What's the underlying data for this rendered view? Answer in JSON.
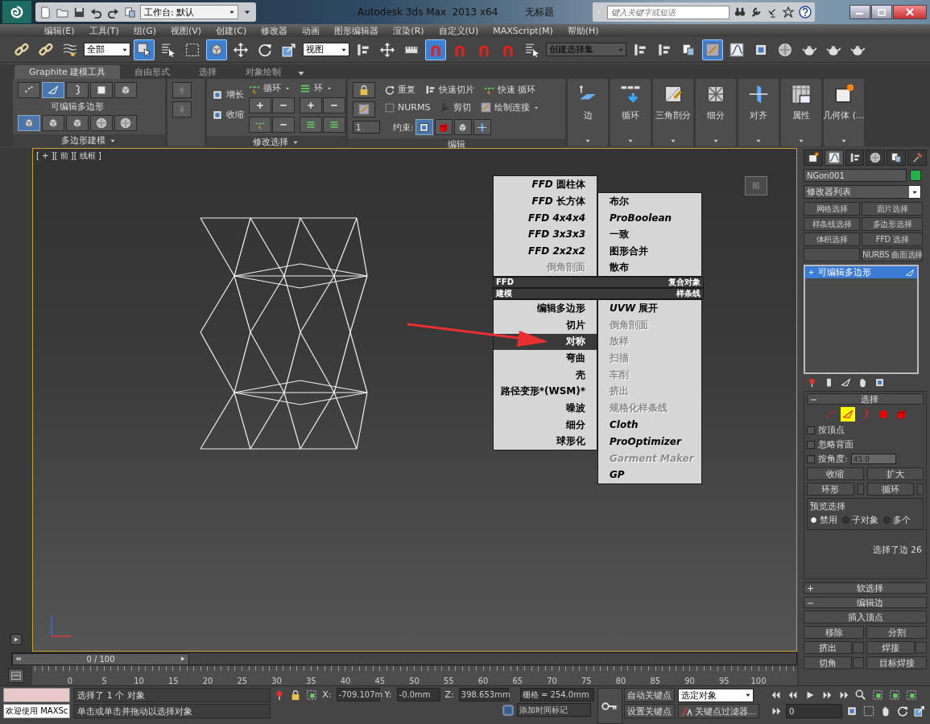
{
  "title_bar": {
    "workspace": "工作台: 默认",
    "app_title": "Autodesk 3ds Max  2013 x64",
    "document": "无标题",
    "search": {
      "placeholder": "键入关键字或短语"
    }
  },
  "menu_bar": [
    "编辑(E)",
    "工具(T)",
    "组(G)",
    "视图(V)",
    "创建(C)",
    "修改器",
    "动画",
    "图形编辑器",
    "渲染(R)",
    "自定义(U)",
    "MAXScript(M)",
    "帮助(H)"
  ],
  "main_toolbar": [
    {
      "kind": "tool",
      "selected": false
    },
    {
      "kind": "tool",
      "selected": false
    },
    {
      "kind": "tool",
      "selected": false
    },
    {
      "kind": "dropdown",
      "value": "全部"
    },
    {
      "kind": "tool",
      "selected": true
    },
    {
      "kind": "tool",
      "selected": false
    },
    {
      "kind": "tool",
      "selected": false
    },
    {
      "kind": "tool",
      "selected": true
    },
    {
      "kind": "tool",
      "selected": false
    },
    {
      "kind": "tool",
      "selected": false
    },
    {
      "kind": "tool",
      "selected": false
    },
    {
      "kind": "dropdown",
      "value": "视图"
    },
    {
      "kind": "tool",
      "selected": false
    },
    {
      "kind": "tool",
      "selected": false
    },
    {
      "kind": "tool",
      "selected": false
    },
    {
      "kind": "tool",
      "selected": true
    },
    {
      "kind": "tool",
      "selected": false
    },
    {
      "kind": "tool",
      "selected": false
    },
    {
      "kind": "tool",
      "selected": false
    },
    {
      "kind": "tool",
      "selected": false
    },
    {
      "kind": "dropdown",
      "value": "创建选择集"
    },
    {
      "kind": "tool",
      "selected": false
    },
    {
      "kind": "tool",
      "selected": false
    },
    {
      "kind": "tool",
      "selected": false
    },
    {
      "kind": "tool",
      "selected": true
    },
    {
      "kind": "tool",
      "selected": false
    },
    {
      "kind": "tool",
      "selected": false
    },
    {
      "kind": "tool",
      "selected": false
    },
    {
      "kind": "tool",
      "selected": false
    },
    {
      "kind": "tool",
      "selected": false
    },
    {
      "kind": "tool",
      "selected": false
    }
  ],
  "ribbon": {
    "tabs": [
      {
        "label": "Graphite 建模工具",
        "selected": true
      },
      {
        "label": "自由形式",
        "selected": false
      },
      {
        "label": "选择",
        "selected": false
      },
      {
        "label": "对象绘制",
        "selected": false
      }
    ],
    "poly_modeling": {
      "subobjects": [
        {
          "selected": false
        },
        {
          "selected": true
        },
        {
          "selected": false
        },
        {
          "selected": false
        },
        {
          "selected": false
        }
      ],
      "object_label": "可编辑多边形",
      "modes": [
        {
          "selected": true
        },
        {
          "selected": false
        },
        {
          "selected": false
        },
        {
          "selected": false
        },
        {
          "selected": false
        }
      ],
      "footer": "多边形建模"
    },
    "modify_selection": {
      "grow": "增长",
      "shrink": "收缩",
      "loop": "循环",
      "ring": "环",
      "footer": "修改选择"
    },
    "edit": {
      "repeat": "重复",
      "quick_slice": "快速切片",
      "quick_loop": "快速 循环",
      "nurms": "NURMS",
      "cut": "剪切",
      "paint_connect": "绘制连接",
      "constraints": "约束:",
      "spinner": "1",
      "footer": "编辑"
    },
    "large_buttons": [
      "边",
      "循环",
      "三角剖分",
      "细分",
      "对齐",
      "属性",
      "几何体 (..."
    ]
  },
  "viewport": {
    "label": "[ + ][ 前 ][ 线框 ]",
    "viewcube": "前",
    "quad_menu": {
      "left_top": [
        {
          "label": "*FFD* 圆柱体",
          "disabled": false,
          "selected": false
        },
        {
          "label": "*FFD* 长方体",
          "disabled": false,
          "selected": false
        },
        {
          "label": "FFD 4x4x4",
          "italic": true,
          "disabled": false,
          "selected": false
        },
        {
          "label": "FFD 3x3x3",
          "italic": true,
          "disabled": false,
          "selected": false
        },
        {
          "label": "FFD 2x2x2",
          "italic": true,
          "disabled": false,
          "selected": false
        },
        {
          "label": "倒角剖面",
          "disabled": true,
          "selected": false
        }
      ],
      "right_top": [
        {
          "label": "布尔",
          "disabled": false,
          "selected": false
        },
        {
          "label": "ProBoolean",
          "italic": true,
          "disabled": false,
          "selected": false
        },
        {
          "label": "一致",
          "disabled": false,
          "selected": false
        },
        {
          "label": "图形合并",
          "disabled": false,
          "selected": false
        },
        {
          "label": "散布",
          "disabled": false,
          "selected": false
        }
      ],
      "headers": [
        {
          "left": "FFD",
          "right": "复合对象"
        },
        {
          "left": "建模",
          "right": "样条线"
        }
      ],
      "left_bottom": [
        {
          "label": "编辑多边形",
          "disabled": false,
          "selected": false
        },
        {
          "label": "切片",
          "disabled": false,
          "selected": false
        },
        {
          "label": "对称",
          "disabled": false,
          "selected": true
        },
        {
          "label": "弯曲",
          "disabled": false,
          "selected": false
        },
        {
          "label": "壳",
          "disabled": false,
          "selected": false
        },
        {
          "label": "路径变形*(WSM)*",
          "disabled": false,
          "selected": false
        },
        {
          "label": "噪波",
          "disabled": false,
          "selected": false
        },
        {
          "label": "细分",
          "disabled": false,
          "selected": false
        },
        {
          "label": "球形化",
          "disabled": false,
          "selected": false
        }
      ],
      "right_bottom": [
        {
          "label": "*UVW* 展开",
          "disabled": false,
          "selected": false
        },
        {
          "label": "倒角剖面",
          "disabled": true,
          "selected": false
        },
        {
          "label": "放样",
          "disabled": true,
          "selected": false
        },
        {
          "label": "扫描",
          "disabled": true,
          "selected": false
        },
        {
          "label": "车削",
          "disabled": true,
          "selected": false
        },
        {
          "label": "挤出",
          "disabled": true,
          "selected": false
        },
        {
          "label": "规格化样条线",
          "disabled": true,
          "selected": false
        },
        {
          "label": "Cloth",
          "italic": true,
          "disabled": false,
          "selected": false
        },
        {
          "label": "ProOptimizer",
          "italic": true,
          "disabled": false,
          "selected": false
        },
        {
          "label": "Garment Maker",
          "italic": true,
          "disabled": true,
          "selected": false
        },
        {
          "label": "GP",
          "italic": true,
          "disabled": false,
          "selected": false
        }
      ]
    }
  },
  "command_panel": {
    "tabs": [
      {
        "selected": false
      },
      {
        "selected": true
      },
      {
        "selected": false
      },
      {
        "selected": false
      },
      {
        "selected": false
      },
      {
        "selected": false
      }
    ],
    "object_name": {
      "value": "NGon001",
      "color": "#22b14c"
    },
    "modifier_list": "修改器列表",
    "modifier_sets": [
      {
        "kind": "set",
        "label": "网格选择"
      },
      {
        "kind": "set",
        "label": "面片选择"
      },
      {
        "kind": "set",
        "label": "样条线选择"
      },
      {
        "kind": "set",
        "label": "多边形选择"
      },
      {
        "kind": "set",
        "label": "体积选择"
      },
      {
        "kind": "set",
        "label": "FFD 选择"
      },
      {
        "kind": "blank"
      },
      {
        "kind": "set",
        "label": "NURBS 曲面选择"
      }
    ],
    "stack": [
      {
        "label": "可编辑多边形",
        "selected": true
      }
    ],
    "selection": {
      "title": "选择",
      "expanded": true,
      "subobjects": [
        {
          "selected": false
        },
        {
          "selected": true
        },
        {
          "selected": false
        },
        {
          "selected": false
        },
        {
          "selected": false
        }
      ],
      "options": [
        {
          "label": "按顶点",
          "checked": false
        },
        {
          "label": "忽略背面",
          "checked": false
        },
        {
          "label": "按角度:",
          "checked": false,
          "value": "45.0"
        }
      ],
      "buttons": [
        "收缩",
        "扩大"
      ],
      "spin_buttons": [
        "环形",
        "循环"
      ],
      "preview": {
        "title": "预览选择",
        "options": [
          {
            "label": "禁用",
            "selected": true
          },
          {
            "label": "子对象",
            "selected": false
          },
          {
            "label": "多个",
            "selected": false
          }
        ]
      },
      "info": "选择了边 26"
    },
    "soft_selection": {
      "title": "软选择",
      "expanded": false
    },
    "edit_edges": {
      "title": "编辑边",
      "expanded": true,
      "buttons": [
        {
          "label": "插入顶点",
          "kind": "wide"
        },
        {
          "label": "移除",
          "kind": "plain"
        },
        {
          "label": "分割",
          "kind": "plain"
        },
        {
          "label": "挤出",
          "kind": "settings"
        },
        {
          "label": "焊接",
          "kind": "settings"
        },
        {
          "label": "切角",
          "kind": "settings"
        },
        {
          "label": "目标焊接",
          "kind": "plain"
        }
      ]
    }
  },
  "time_slider": {
    "label": "0 / 100"
  },
  "track_bar": [
    "0",
    "5",
    "10",
    "15",
    "20",
    "25",
    "30",
    "35",
    "40",
    "45",
    "50",
    "55",
    "60",
    "65",
    "70",
    "75",
    "80",
    "85",
    "90",
    "95",
    "100"
  ],
  "status_bar": {
    "listener": "欢迎使用 MAXSc",
    "prompt": "选择了 1 个 对象",
    "hint": "单击或单击并拖动以选择对象",
    "coords": [
      {
        "axis": "X:",
        "value": "-709.107m"
      },
      {
        "axis": "Y:",
        "value": "-0.0mm"
      },
      {
        "axis": "Z:",
        "value": "398.653mm"
      }
    ],
    "grid": "栅格 = 254.0mm",
    "time_tag": "添加时间标记",
    "auto_key": "自动关键点",
    "set_key": "设置关键点",
    "key_mode": "选定对象",
    "key_filters": "关键点过滤器...",
    "frame": "0"
  }
}
